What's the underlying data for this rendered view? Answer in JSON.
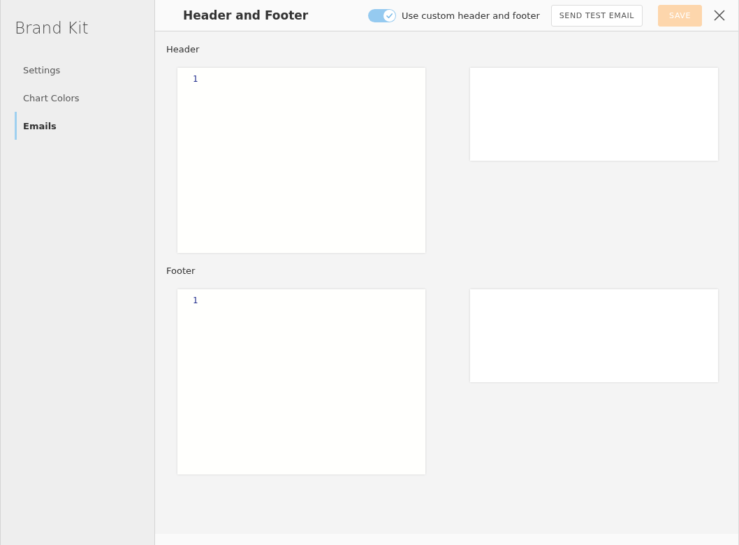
{
  "sidebar": {
    "title": "Brand Kit",
    "items": [
      {
        "label": "Settings",
        "selected": false
      },
      {
        "label": "Chart Colors",
        "selected": false
      },
      {
        "label": "Emails",
        "selected": true
      }
    ]
  },
  "header_bar": {
    "title": "Header and Footer",
    "toggle": {
      "label": "Use custom header and footer",
      "on": true
    },
    "buttons": [
      {
        "kind": "outline",
        "label": "SEND TEST EMAIL",
        "disabled": false
      },
      {
        "kind": "primary",
        "label": "SAVE",
        "disabled": true
      }
    ]
  },
  "sections": [
    {
      "label": "Header",
      "editor": {
        "line_numbers": [
          "1"
        ]
      }
    },
    {
      "label": "Footer",
      "editor": {
        "line_numbers": [
          "1"
        ]
      }
    }
  ]
}
